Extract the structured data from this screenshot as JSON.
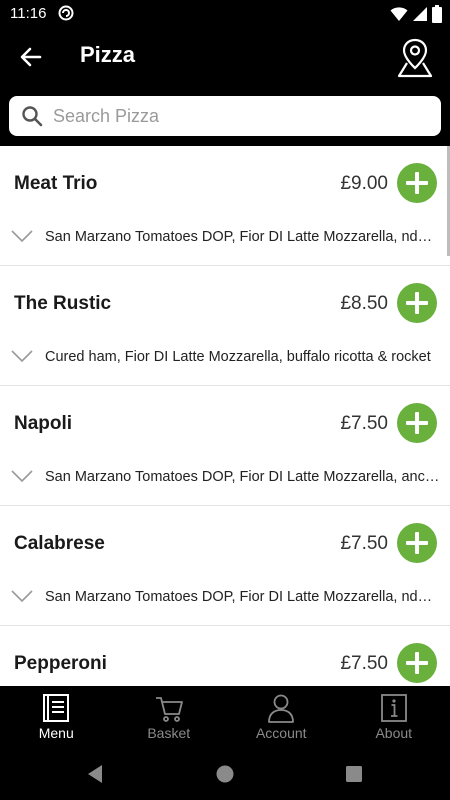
{
  "status_bar": {
    "time": "11:16"
  },
  "app_bar": {
    "title": "Pizza"
  },
  "search": {
    "placeholder": "Search Pizza",
    "value": ""
  },
  "menu_items": [
    {
      "name": "Meat Trio",
      "price": "£9.00",
      "description": "San Marzano Tomatoes DOP, Fior DI Latte Mozzarella, nduja, salami & ham"
    },
    {
      "name": "The Rustic",
      "price": "£8.50",
      "description": "Cured ham, Fior DI Latte  Mozzarella, buffalo ricotta & rocket"
    },
    {
      "name": "Napoli",
      "price": "£7.50",
      "description": "San Marzano Tomatoes DOP, Fior DI Latte Mozzarella, anchovies & capers"
    },
    {
      "name": "Calabrese",
      "price": "£7.50",
      "description": "San Marzano Tomatoes DOP, Fior DI Latte Mozzarella, nduja & red onion"
    },
    {
      "name": "Pepperoni",
      "price": "£7.50",
      "description": ""
    }
  ],
  "bottom_nav": [
    {
      "label": "Menu",
      "icon": "menu-book-icon",
      "active": true
    },
    {
      "label": "Basket",
      "icon": "basket-icon",
      "active": false
    },
    {
      "label": "Account",
      "icon": "account-icon",
      "active": false
    },
    {
      "label": "About",
      "icon": "info-icon",
      "active": false
    }
  ],
  "colors": {
    "accent": "#6ab03d",
    "bar_background": "#000000",
    "inactive_nav": "#8a8a8a"
  }
}
